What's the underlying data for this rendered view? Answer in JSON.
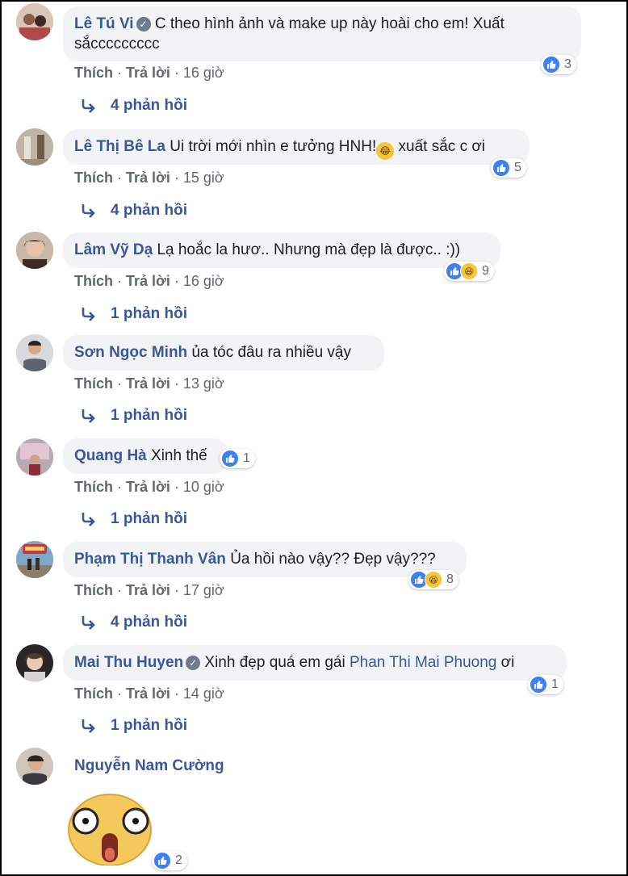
{
  "comments": [
    {
      "name": "Lê Tú Vi",
      "verified": true,
      "text_line1": "C theo hình ảnh và make up này hoài cho em! Xuất",
      "text_line2": "sắccccccccc",
      "reaction_count": "3",
      "actions": {
        "like": "Thích",
        "reply": "Trả lời",
        "time": "16 giờ"
      },
      "replies": "4 phản hồi"
    },
    {
      "name": "Lê Thị Bê La",
      "text_before": "Ui trời mới nhìn e tưởng HNH!",
      "text_after": " xuất sắc c ơi",
      "reaction_count": "5",
      "actions": {
        "like": "Thích",
        "reply": "Trả lời",
        "time": "15 giờ"
      },
      "replies": "4 phản hồi"
    },
    {
      "name": "Lâm Vỹ Dạ",
      "text": "Lạ hoắc la hươ.. Nhưng mà đẹp là được.. :))",
      "reaction_count": "9",
      "actions": {
        "like": "Thích",
        "reply": "Trả lời",
        "time": "16 giờ"
      },
      "replies": "1 phản hồi"
    },
    {
      "name": "Sơn Ngọc Minh",
      "text": "ủa tóc đâu ra nhiều vậy",
      "actions": {
        "like": "Thích",
        "reply": "Trả lời",
        "time": "13 giờ"
      },
      "replies": "1 phản hồi"
    },
    {
      "name": "Quang Hà",
      "text": "Xinh thế",
      "reaction_count": "1",
      "actions": {
        "like": "Thích",
        "reply": "Trả lời",
        "time": "10 giờ"
      },
      "replies": "1 phản hồi"
    },
    {
      "name": "Phạm Thị Thanh Vân",
      "text": "Ủa hồi nào vậy?? Đẹp vậy???",
      "reaction_count": "8",
      "actions": {
        "like": "Thích",
        "reply": "Trả lời",
        "time": "17 giờ"
      },
      "replies": "4 phản hồi"
    },
    {
      "name": "Mai Thu Huyen",
      "verified": true,
      "text": "Xinh đẹp quá em gái ",
      "mention": "Phan Thi Mai Phuong",
      "text_after": " ơi",
      "reaction_count": "1",
      "actions": {
        "like": "Thích",
        "reply": "Trả lời",
        "time": "14 giờ"
      },
      "replies": "1 phản hồi"
    },
    {
      "name": "Nguyễn Nam Cường",
      "reaction_count": "2"
    }
  ],
  "colors": {
    "name": "#385898",
    "bubble": "#f2f3f5",
    "like": "#3b82f6",
    "haha": "#f7c53b",
    "meta": "#606770"
  },
  "icons": {
    "like": "like-icon",
    "haha": "haha-icon",
    "reply": "reply-arrow-icon",
    "verified": "verified-badge-icon"
  }
}
